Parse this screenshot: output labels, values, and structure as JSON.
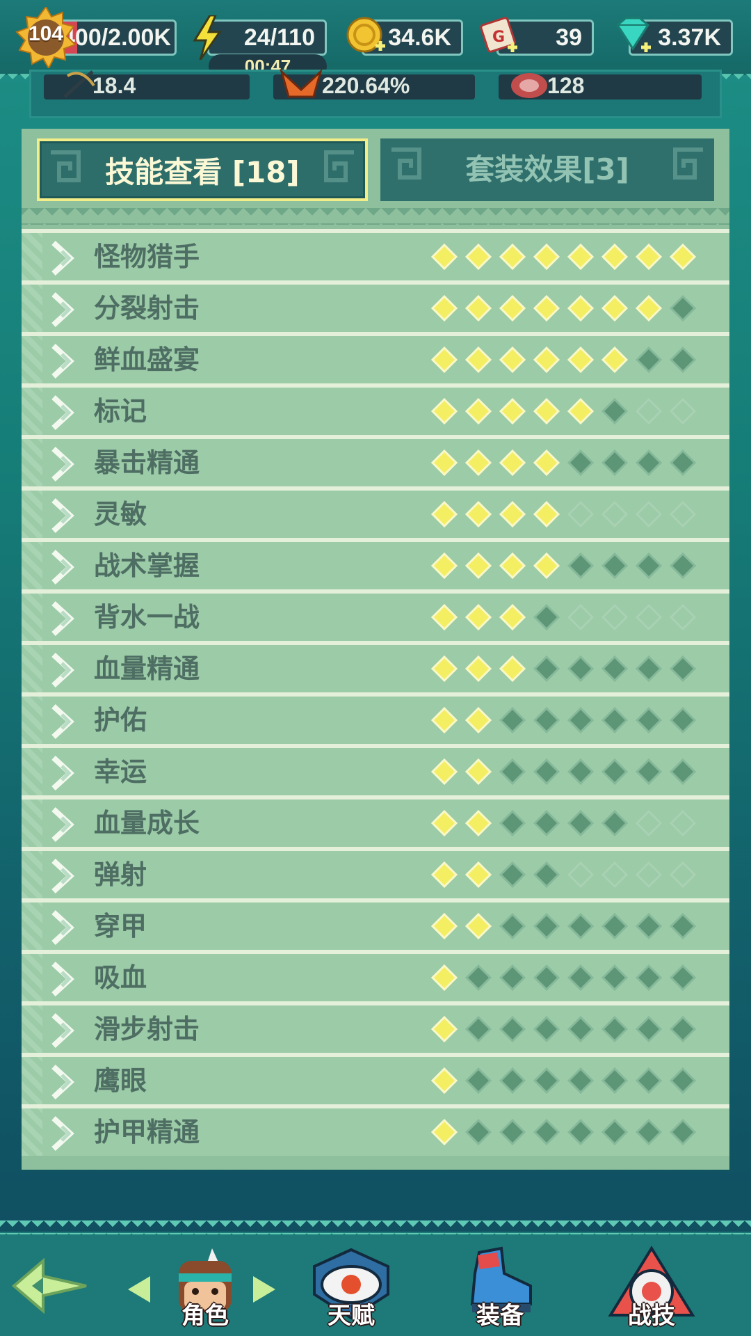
{
  "topbar": {
    "level": "104",
    "xp": "400/2.00K",
    "energy": "24/110",
    "energy_timer": "00:47",
    "gold": "34.6K",
    "scrolls": "39",
    "gems": "3.37K"
  },
  "stats": {
    "attack": "18.4",
    "crit": "220.64%",
    "meat": "128"
  },
  "tabs": {
    "skills": "技能查看 [18]",
    "sets": "套装效果[3]"
  },
  "skills": [
    {
      "name": "怪物猎手",
      "lit": 8,
      "max": 8
    },
    {
      "name": "分裂射击",
      "lit": 7,
      "max": 8
    },
    {
      "name": "鲜血盛宴",
      "lit": 6,
      "max": 8
    },
    {
      "name": "标记",
      "lit": 5,
      "max": 6
    },
    {
      "name": "暴击精通",
      "lit": 4,
      "max": 8
    },
    {
      "name": "灵敏",
      "lit": 4,
      "max": 4
    },
    {
      "name": "战术掌握",
      "lit": 4,
      "max": 8
    },
    {
      "name": "背水一战",
      "lit": 3,
      "max": 4
    },
    {
      "name": "血量精通",
      "lit": 3,
      "max": 8
    },
    {
      "name": "护佑",
      "lit": 2,
      "max": 8
    },
    {
      "name": "幸运",
      "lit": 2,
      "max": 8
    },
    {
      "name": "血量成长",
      "lit": 2,
      "max": 6
    },
    {
      "name": "弹射",
      "lit": 2,
      "max": 4
    },
    {
      "name": "穿甲",
      "lit": 2,
      "max": 8
    },
    {
      "name": "吸血",
      "lit": 1,
      "max": 8
    },
    {
      "name": "滑步射击",
      "lit": 1,
      "max": 8
    },
    {
      "name": "鹰眼",
      "lit": 1,
      "max": 8
    },
    {
      "name": "护甲精通",
      "lit": 1,
      "max": 8
    }
  ],
  "nav": {
    "character": "角色",
    "talent": "天赋",
    "equipment": "装备",
    "combat": "战技"
  },
  "colors": {
    "pip_lit": "#f4ee62",
    "pip_unlit": "#5d9677",
    "accent": "#f4ee89"
  }
}
